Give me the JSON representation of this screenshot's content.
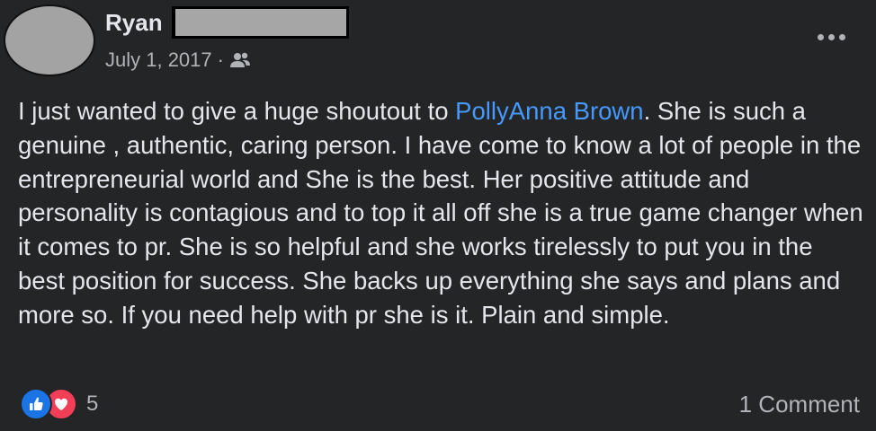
{
  "post": {
    "author": {
      "name": "Ryan"
    },
    "date": "July 1, 2017",
    "separator": "·",
    "audience_icon": "friends-icon",
    "more_icon": "more-options-icon",
    "body": {
      "before_mention": "I just wanted to give a huge shoutout to ",
      "mention": "PollyAnna Brown",
      "after_mention": ". She is such a genuine , authentic, caring person. I have come to know a lot of people in the entrepreneurial world and She is the best. Her positive attitude and personality is contagious and to top it all off she is a true game changer when it comes to pr. She is so helpful and she works tirelessly to put you in the best position for success. She backs up everything she says and plans and more so. If you need help with pr she is it. Plain and simple."
    },
    "reactions": {
      "icons": [
        "like-icon",
        "love-icon"
      ],
      "count": "5"
    },
    "comments_label": "1 Comment"
  },
  "colors": {
    "background": "#242526",
    "primary_text": "#e4e6eb",
    "secondary_text": "#b0b3b8",
    "mention": "#4599ff",
    "like": "#1b74e4",
    "love": "#f33e58"
  }
}
